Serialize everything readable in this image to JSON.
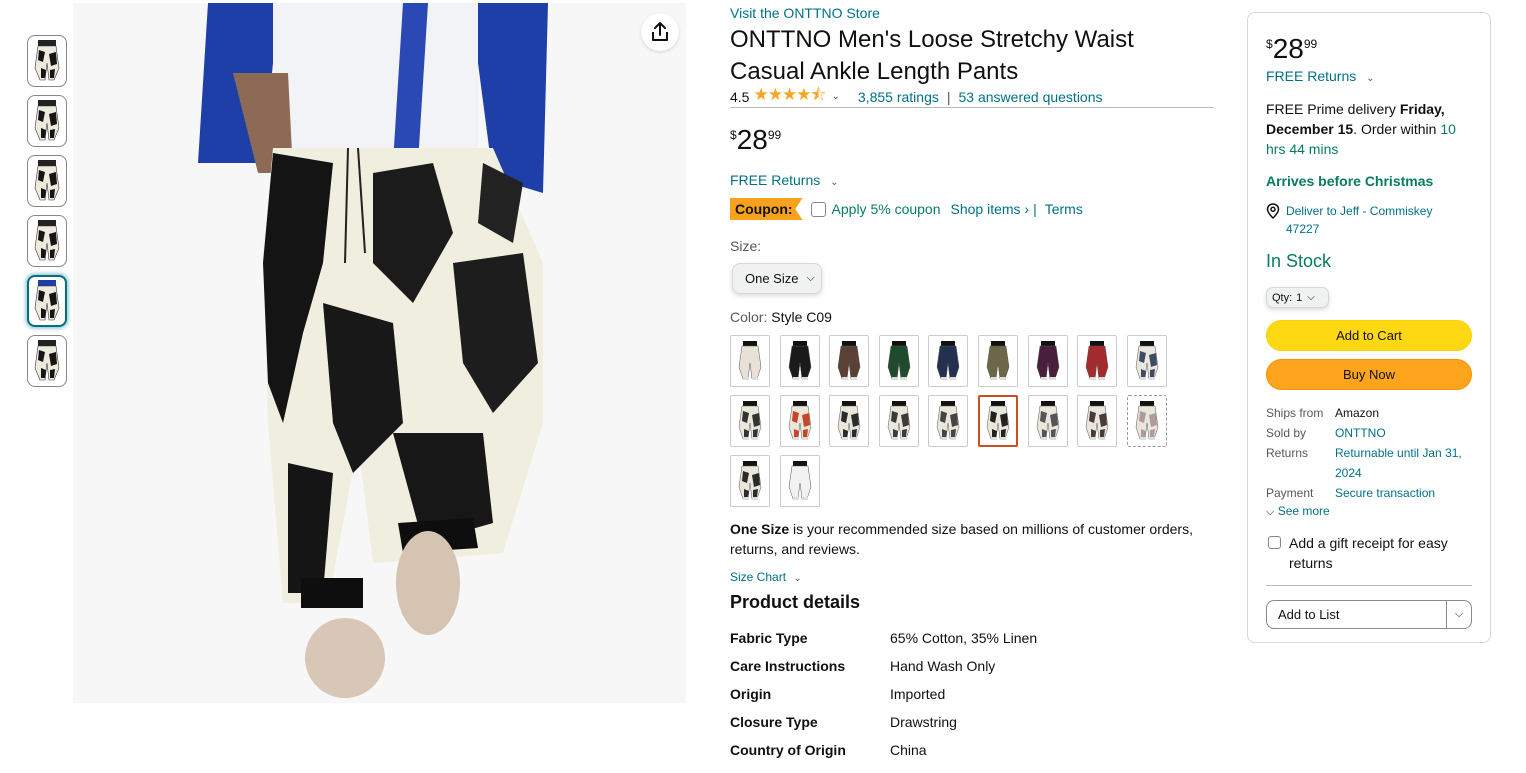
{
  "thumbnails": [
    {
      "pattern": "splatter"
    },
    {
      "pattern": "splatter"
    },
    {
      "pattern": "splatter"
    },
    {
      "pattern": "splatter"
    },
    {
      "pattern": "blue-jacket",
      "selected": true
    },
    {
      "pattern": "splatter"
    }
  ],
  "share_icon": "share-icon",
  "product": {
    "store_link": "Visit the ONTTNO Store",
    "title": "ONTTNO Men's Loose Stretchy Waist Casual Ankle Length Pants",
    "rating": "4.5",
    "stars": "★★★★⯪",
    "ratings_count": "3,855 ratings",
    "separator": "|",
    "answered": "53 answered questions",
    "price_symbol": "$",
    "price_whole": "28",
    "price_fraction": "99",
    "free_returns": "FREE Returns",
    "coupon_label": "Coupon:",
    "coupon_text": "Apply 5% coupon",
    "shop_items": "Shop items ›",
    "coupon_sep": "|",
    "terms": "Terms",
    "size_label": "Size:",
    "size_value": "One Size",
    "color_label": "Color:",
    "color_value": "Style C09",
    "recommendation_bold": "One Size",
    "recommendation_rest": " is your recommended size based on millions of customer orders, returns, and reviews.",
    "size_chart": "Size Chart",
    "details_title": "Product details",
    "details": [
      {
        "k": "Fabric Type",
        "v": "65% Cotton, 35% Linen"
      },
      {
        "k": "Care Instructions",
        "v": "Hand Wash Only"
      },
      {
        "k": "Origin",
        "v": "Imported"
      },
      {
        "k": "Closure Type",
        "v": "Drawstring"
      },
      {
        "k": "Country of Origin",
        "v": "China"
      }
    ]
  },
  "swatches": [
    {
      "color": "#e8e2d6",
      "pattern": "solid"
    },
    {
      "color": "#1a1a1a",
      "pattern": "solid"
    },
    {
      "color": "#5a4035",
      "pattern": "solid"
    },
    {
      "color": "#1f4a2e",
      "pattern": "solid"
    },
    {
      "color": "#23304f",
      "pattern": "solid"
    },
    {
      "color": "#6e6648",
      "pattern": "solid"
    },
    {
      "color": "#4a1f3c",
      "pattern": "solid"
    },
    {
      "color": "#a42a2e",
      "pattern": "solid"
    },
    {
      "color": "#3e4a66",
      "pattern": "print"
    },
    {
      "color": "#333333",
      "pattern": "print"
    },
    {
      "color": "#c8442a",
      "pattern": "print"
    },
    {
      "color": "#2b2b2b",
      "pattern": "print"
    },
    {
      "color": "#3b3b3b",
      "pattern": "print"
    },
    {
      "color": "#444444",
      "pattern": "print"
    },
    {
      "color": "#222222",
      "pattern": "print",
      "selected": true
    },
    {
      "color": "#555555",
      "pattern": "print"
    },
    {
      "color": "#4b3a3a",
      "pattern": "print"
    },
    {
      "color": "#b09aa0",
      "pattern": "print",
      "unavailable": true
    },
    {
      "color": "#2a2a2a",
      "pattern": "print"
    },
    {
      "color": "#f2f2f2",
      "pattern": "solid"
    }
  ],
  "buybox": {
    "price_symbol": "$",
    "price_whole": "28",
    "price_fraction": "99",
    "free_returns": "FREE Returns",
    "delivery_prefix": "FREE Prime delivery ",
    "delivery_date": "Friday, December 15",
    "delivery_mid": ". Order within ",
    "delivery_countdown": "10 hrs 44 mins",
    "christmas": "Arrives before Christmas",
    "deliver_to": "Deliver to Jeff - Commiskey 47227",
    "stock": "In Stock",
    "qty_label": "Qty:",
    "qty_value": "1",
    "add_to_cart": "Add to Cart",
    "buy_now": "Buy Now",
    "info": [
      {
        "k": "Ships from",
        "v": "Amazon",
        "link": false
      },
      {
        "k": "Sold by",
        "v": "ONTTNO",
        "link": true
      },
      {
        "k": "Returns",
        "v": "Returnable until Jan 31, 2024",
        "link": true
      },
      {
        "k": "Payment",
        "v": "Secure transaction",
        "link": true
      }
    ],
    "see_more": "See more",
    "gift": "Add a gift receipt for easy returns",
    "add_to_list": "Add to List"
  },
  "colors": {
    "link": "#007185",
    "green": "#067d62",
    "cart_yellow": "#ffd814",
    "buy_orange": "#ffa41c",
    "coupon_orange": "#f7a21c",
    "star": "#f5a623"
  }
}
